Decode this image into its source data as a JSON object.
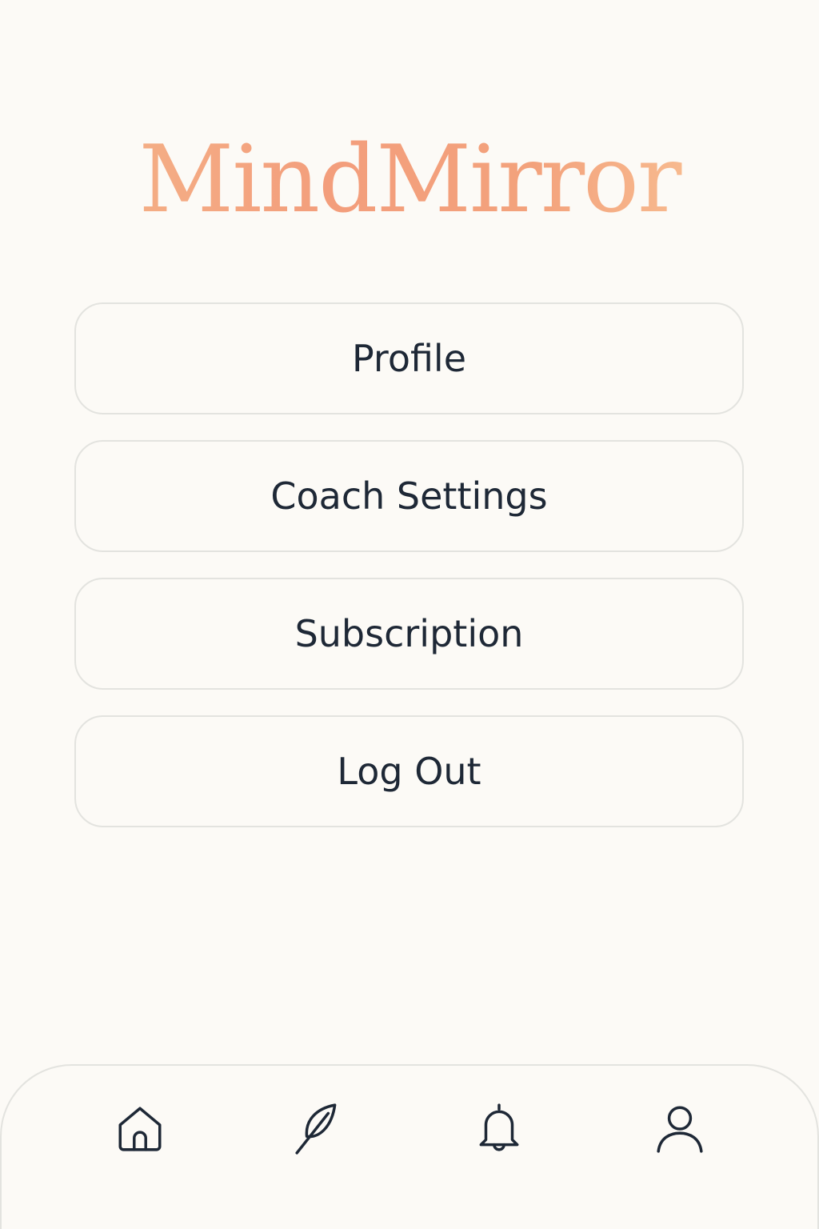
{
  "app": {
    "title": "MindMirror"
  },
  "menu": {
    "items": [
      {
        "label": "Profile"
      },
      {
        "label": "Coach Settings"
      },
      {
        "label": "Subscription"
      },
      {
        "label": "Log Out"
      }
    ]
  },
  "tabbar": {
    "items": [
      {
        "icon": "home-icon"
      },
      {
        "icon": "feather-icon"
      },
      {
        "icon": "bell-icon"
      },
      {
        "icon": "user-icon"
      }
    ]
  },
  "colors": {
    "background": "#fcfaf6",
    "brand_gradient_start": "#f5b98c",
    "brand_gradient_mid": "#f39e7c",
    "brand_gradient_end": "#fbcf9f",
    "text": "#1e2836",
    "border": "#e3e3df",
    "icon": "#1e2836"
  }
}
